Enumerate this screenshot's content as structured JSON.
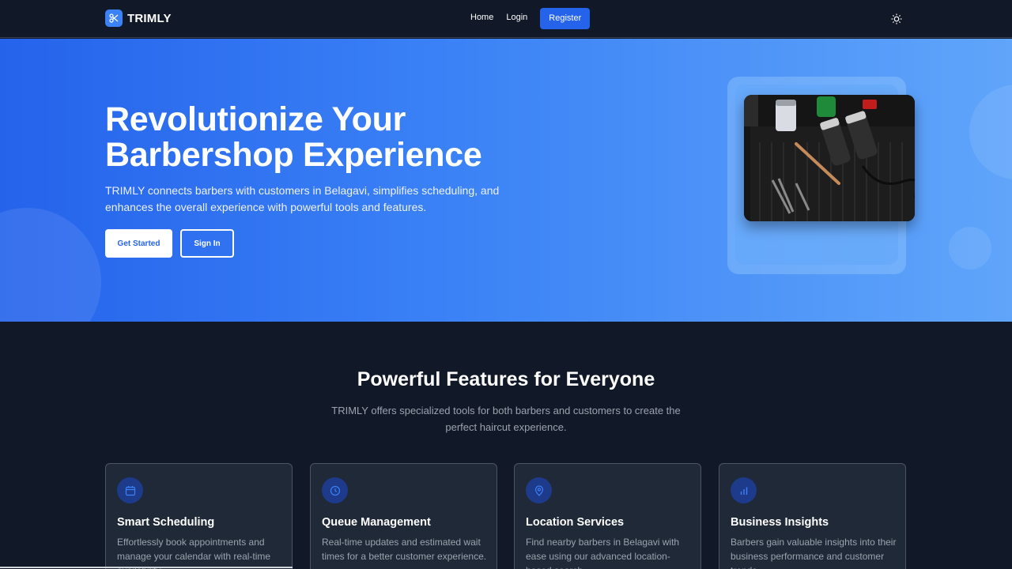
{
  "nav": {
    "brand": "TRIMLY",
    "links": [
      "Home",
      "Login"
    ],
    "register_label": "Register"
  },
  "hero": {
    "title_line1": "Revolutionize Your",
    "title_line2": "Barbershop Experience",
    "description": "TRIMLY connects barbers with customers in Belagavi, simplifies scheduling, and enhances the overall experience with powerful tools and features.",
    "primary_button": "Get Started",
    "secondary_button": "Sign In"
  },
  "features": {
    "title": "Powerful Features for Everyone",
    "subtitle": "TRIMLY offers specialized tools for both barbers and customers to create the perfect haircut experience.",
    "cards": [
      {
        "icon": "calendar-icon",
        "title": "Smart Scheduling",
        "text": "Effortlessly book appointments and manage your calendar with real-time availability."
      },
      {
        "icon": "clock-icon",
        "title": "Queue Management",
        "text": "Real-time updates and estimated wait times for a better customer experience."
      },
      {
        "icon": "map-pin-icon",
        "title": "Location Services",
        "text": "Find nearby barbers in Belagavi with ease using our advanced location-based search."
      },
      {
        "icon": "bar-chart-icon",
        "title": "Business Insights",
        "text": "Barbers gain valuable insights into their business performance and customer trends."
      }
    ]
  },
  "colors": {
    "accent": "#2563eb",
    "hero_start": "#2563eb",
    "hero_end": "#60a5fa",
    "background": "#111827",
    "card": "#1f2937"
  }
}
